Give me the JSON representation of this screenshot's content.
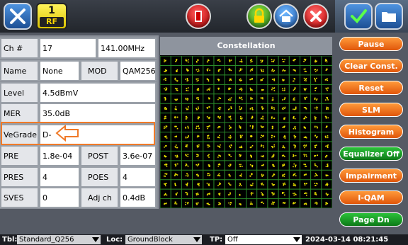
{
  "top": {
    "rf_number": "1",
    "rf_label": "RF"
  },
  "table": {
    "channel_label": "Ch #",
    "channel_value": "17",
    "frequency": "141.00MHz",
    "name_label": "Name",
    "name_value": "None",
    "mod_label": "MOD",
    "mod_value": "QAM256",
    "level_label": "Level",
    "level_value": "4.5dBmV",
    "mer_label": "MER",
    "mer_value": "35.0dB",
    "vegrade_label": "VeGrade",
    "vegrade_value": "D-",
    "pre_label": "PRE",
    "pre_value": "1.8e-04",
    "post_label": "POST",
    "post_value": "3.6e-07",
    "pres_label": "PRES",
    "pres_value": "4",
    "poes_label": "POES",
    "poes_value": "4",
    "sves_label": "SVES",
    "sves_value": "0",
    "adjch_label": "Adj ch",
    "adjch_value": "0.4dB"
  },
  "constellation": {
    "title": "Constellation",
    "grid_size": 16,
    "dot_color": "#e8e000",
    "grid_color": "#2a8a2a"
  },
  "sidebar": {
    "buttons": [
      {
        "label": "Pause",
        "color": "orange"
      },
      {
        "label": "Clear Const.",
        "color": "orange"
      },
      {
        "label": "Reset",
        "color": "orange"
      },
      {
        "label": "SLM",
        "color": "orange"
      },
      {
        "label": "Histogram",
        "color": "orange"
      },
      {
        "label": "Equalizer Off",
        "color": "green"
      },
      {
        "label": "Impairment",
        "color": "orange"
      },
      {
        "label": "I-QAM",
        "color": "orange"
      },
      {
        "label": "Page Dn",
        "color": "green"
      }
    ]
  },
  "status": {
    "tbl_label": "Tbl:",
    "tbl_value": "Standard_Q256",
    "loc_label": "Loc:",
    "loc_value": "GroundBlock",
    "tp_label": "TP:",
    "tp_value": "Off",
    "datetime": "2024-03-14  08:21:45"
  }
}
